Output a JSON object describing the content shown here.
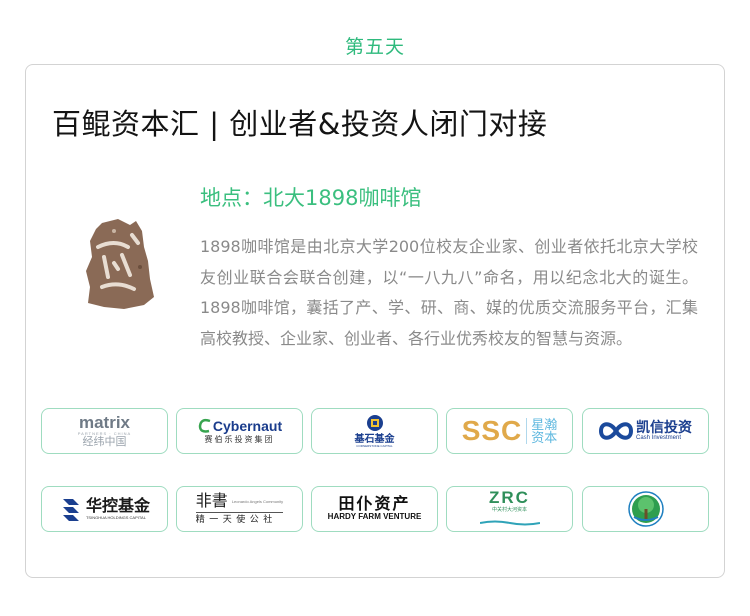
{
  "header": {
    "day_label": "第五天"
  },
  "event": {
    "title": "百鲲资本汇 | 创业者&投资人闭门对接",
    "location": "地点：北大1898咖啡馆",
    "description": "1898咖啡馆是由北京大学200位校友企业家、创业者依托北京大学校友创业联合会联合创建，以“一八九八”命名，用以纪念北大的诞生。1898咖啡馆，囊括了产、学、研、商、媒的优质交流服务平台，汇集高校教授、企业家、创业者、各行业优秀校友的智慧与资源。"
  },
  "partners": [
    {
      "name": "matrix",
      "sub": "PARTNERS · CHINA",
      "cn": "经纬中国"
    },
    {
      "name": "Cybernaut",
      "cn": "赛伯乐投资集团"
    },
    {
      "name": "基石基金",
      "sub": "CORNERSTONE CAPITAL"
    },
    {
      "name": "SSC",
      "cn1": "星瀚",
      "cn2": "资本"
    },
    {
      "name": "凯信投资",
      "sub": "Cash Investment"
    },
    {
      "name": "华控基金",
      "sub": "TSINGHUA HOLDINGS CAPITAL"
    },
    {
      "name": "非書",
      "sub": "Leonardo Angels Community",
      "cn": "精 一 天 使 公 社"
    },
    {
      "name": "田仆资产",
      "sub": "HARDY FARM VENTURE"
    },
    {
      "name": "ZRC",
      "cn": "中关村大河资本"
    },
    {
      "name": "tree-logo"
    }
  ],
  "colors": {
    "accent": "#2fba7d",
    "border": "#9fdcc0",
    "text": "#141414",
    "muted": "#8a8a8a"
  }
}
